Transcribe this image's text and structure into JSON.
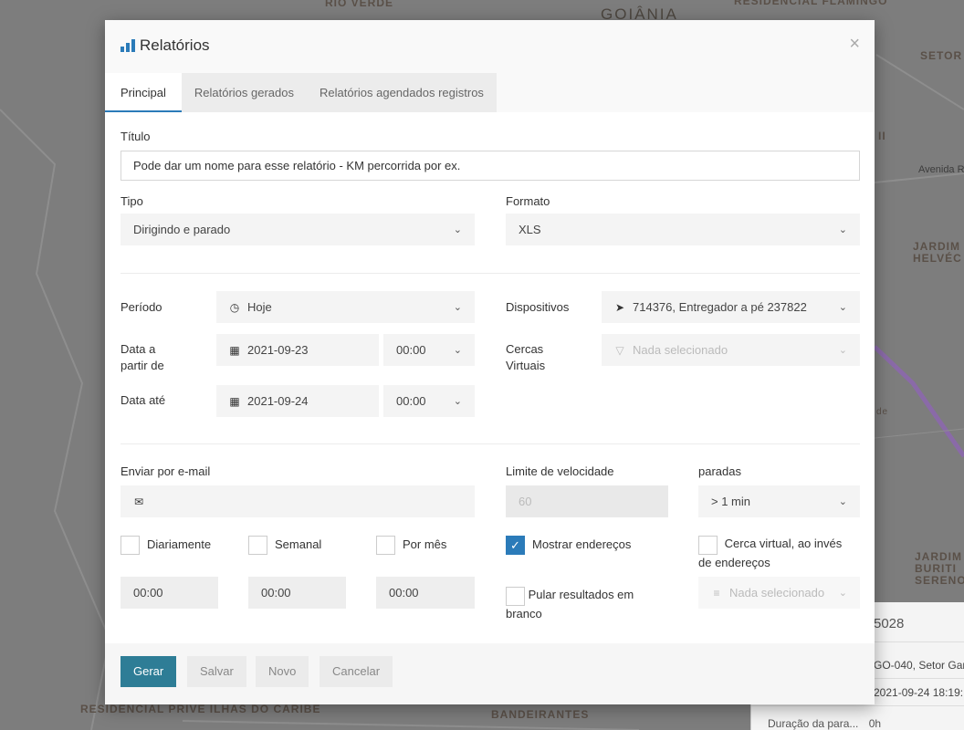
{
  "map": {
    "labels": [
      "RIO VERDE",
      "Goiânia",
      "RESIDENCIAL FLAMINGO",
      "SETOR",
      "Avenida R",
      "JARDIM HELVÉC",
      "JARDIM BURITI SERENO",
      "RESIDENCIAL PRIVÊ ILHAS DO CARIBE",
      "BANDEIRANTES",
      "de",
      "II"
    ],
    "panel": {
      "id": "5028",
      "address": "GO-040, Setor Gar",
      "datetime": "2021-09-24 18:19:",
      "duration_label": "Duração da para...",
      "duration_value": "0h"
    }
  },
  "modal": {
    "title": "Relatórios",
    "close": "×",
    "tabs": [
      "Principal",
      "Relatórios gerados",
      "Relatórios agendados registros"
    ],
    "form": {
      "title_label": "Título",
      "title_value": "Pode dar um nome para esse relatório - KM percorrida por ex.",
      "type_label": "Tipo",
      "type_value": "Dirigindo e parado",
      "format_label": "Formato",
      "format_value": "XLS",
      "period_label": "Período",
      "period_value": "Hoje",
      "devices_label": "Dispositivos",
      "devices_value": "714376, Entregador a pé 237822",
      "date_from_label_1": "Data a",
      "date_from_label_2": "partir de",
      "date_from_value": "2021-09-23",
      "date_from_time": "00:00",
      "geofence_label_1": "Cercas",
      "geofence_label_2": "Virtuais",
      "geofence_value": "Nada selecionado",
      "date_to_label": "Data até",
      "date_to_value": "2021-09-24",
      "date_to_time": "00:00",
      "email_label": "Enviar por e-mail",
      "email_value": "",
      "speed_limit_label": "Limite de velocidade",
      "speed_limit_value": "60",
      "stops_label": "paradas",
      "stops_value": "> 1 min",
      "daily_label": "Diariamente",
      "weekly_label": "Semanal",
      "monthly_label": "Por mês",
      "daily_time": "00:00",
      "weekly_time": "00:00",
      "monthly_time": "00:00",
      "show_addresses_label": "Mostrar endereços",
      "geofence_instead_label_1": "Cerca virtual, ao invés",
      "geofence_instead_label_2": "de endereços",
      "geofence_instead_value": "Nada selecionado",
      "skip_blank_label_1": "Pular resultados em",
      "skip_blank_label_2": "branco"
    },
    "buttons": {
      "generate": "Gerar",
      "save": "Salvar",
      "new": "Novo",
      "cancel": "Cancelar"
    },
    "accent_color": "#2b7bb9",
    "primary_button_color": "#2e7d96"
  }
}
